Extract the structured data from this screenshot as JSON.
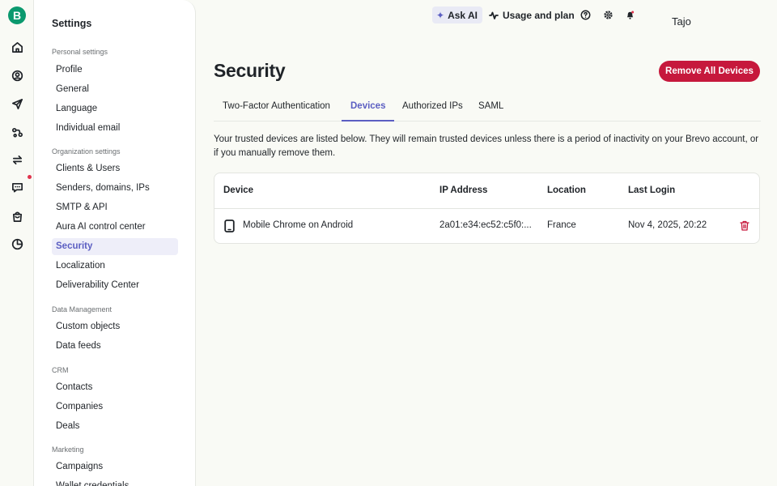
{
  "rail": {
    "logo_letter": "B",
    "icons": [
      "home-icon",
      "contacts-icon",
      "send-icon",
      "automation-icon",
      "transactional-icon",
      "conversations-icon",
      "sales-icon",
      "analytics-icon"
    ],
    "badge_color": "#e0334d"
  },
  "sidebar": {
    "title": "Settings",
    "sections": [
      {
        "label": "Personal settings",
        "items": [
          "Profile",
          "General",
          "Language",
          "Individual email"
        ]
      },
      {
        "label": "Organization settings",
        "items": [
          "Clients & Users",
          "Senders, domains, IPs",
          "SMTP & API",
          "Aura AI control center",
          "Security",
          "Localization",
          "Deliverability Center"
        ]
      },
      {
        "label": "Data Management",
        "items": [
          "Custom objects",
          "Data feeds"
        ]
      },
      {
        "label": "CRM",
        "items": [
          "Contacts",
          "Companies",
          "Deals"
        ]
      },
      {
        "label": "Marketing",
        "items": [
          "Campaigns",
          "Wallet credentials"
        ]
      }
    ],
    "active_item": "Security"
  },
  "topbar": {
    "ask_ai": "Ask AI",
    "usage": "Usage and plan",
    "user_name": "Tajo"
  },
  "main": {
    "title": "Security",
    "remove_button": "Remove All Devices",
    "tabs": [
      {
        "label": "Two-Factor Authentication",
        "active": false
      },
      {
        "label": "Devices",
        "active": true
      },
      {
        "label": "Authorized IPs",
        "active": false
      },
      {
        "label": "SAML",
        "active": false
      }
    ],
    "description": "Your trusted devices are listed below. They will remain trusted devices unless there is a period of inactivity on your Brevo account, or if you manually remove them.",
    "table": {
      "columns": [
        "Device",
        "IP Address",
        "Location",
        "Last Login"
      ],
      "rows": [
        {
          "device": "Mobile Chrome on Android",
          "ip": "2a01:e34:ec52:c5f0:...",
          "location": "France",
          "last_login": "Nov 4, 2025, 20:22"
        }
      ]
    }
  },
  "colors": {
    "brand": "#0b996e",
    "accent": "#5b5ec2",
    "danger": "#c6183c"
  }
}
